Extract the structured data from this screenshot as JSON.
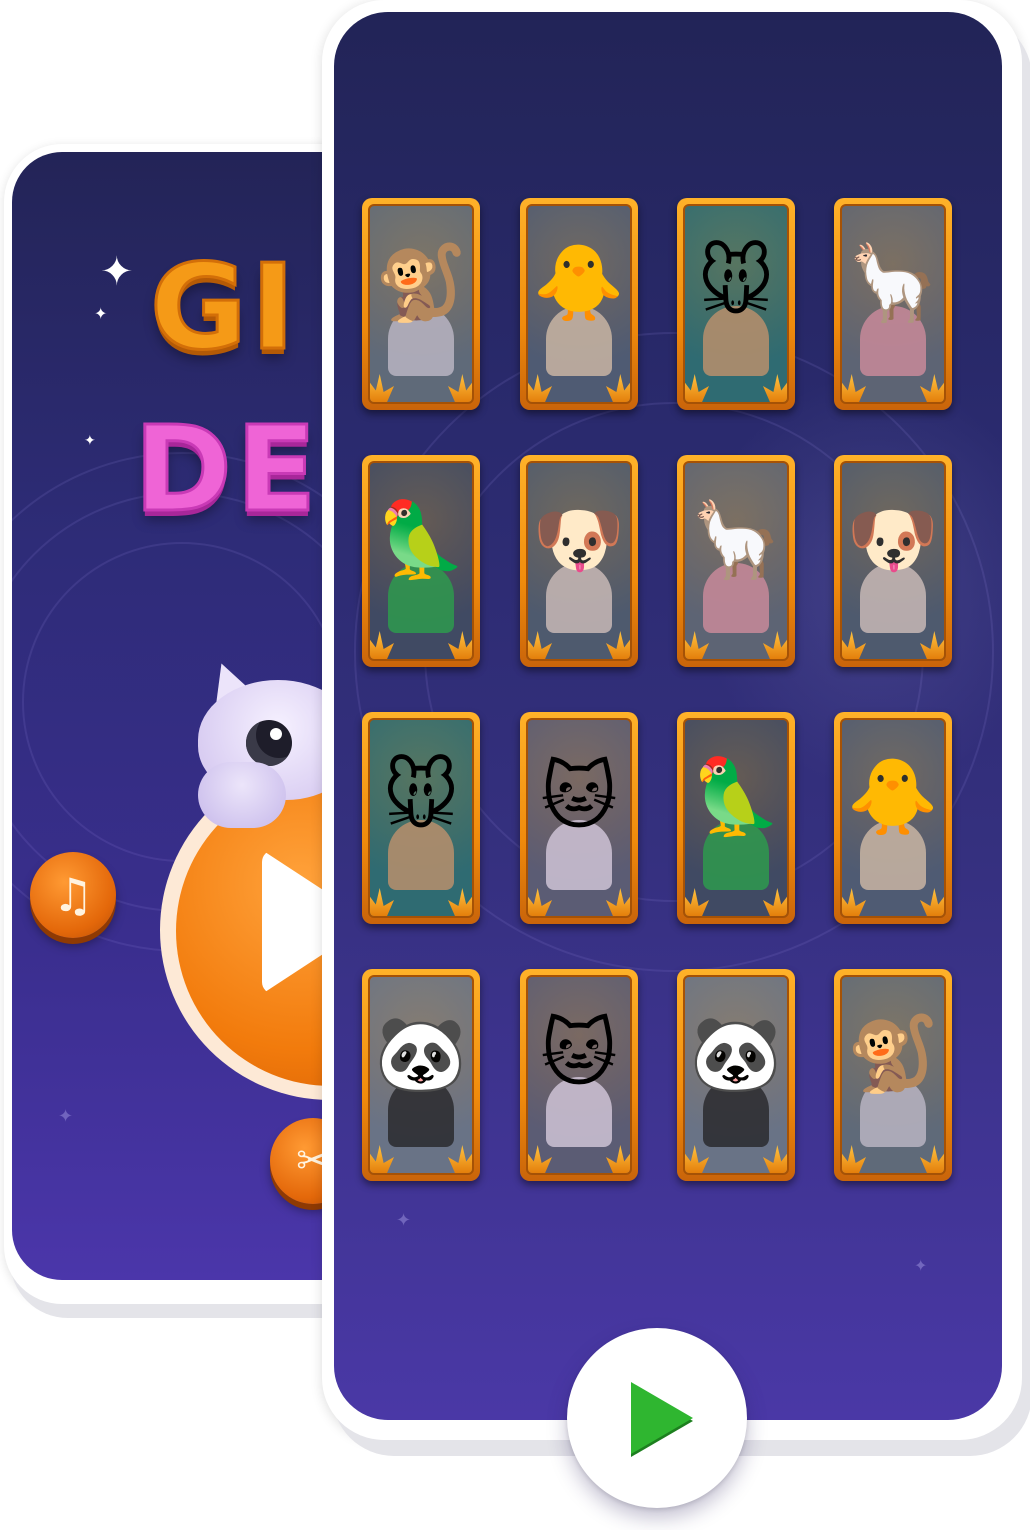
{
  "back_screen": {
    "title_line_1": "GI",
    "title_line_2": "DE",
    "music_icon": "♫",
    "share_icon": "✂"
  },
  "front_screen": {
    "cards": [
      {
        "animal": "monkey",
        "emoji": "🐒",
        "bg": "#5f6a79",
        "body": "#b8b4c2"
      },
      {
        "animal": "chick",
        "emoji": "🐥",
        "bg": "#4f5b73",
        "body": "#c9b5a3"
      },
      {
        "animal": "mouse",
        "emoji": "🐭",
        "bg": "#2f6b72",
        "body": "#b98f6c"
      },
      {
        "animal": "llama",
        "emoji": "🦙",
        "bg": "#5d6474",
        "body": "#c88a9a"
      },
      {
        "animal": "parrot",
        "emoji": "🦜",
        "bg": "#404a63",
        "body": "#2e9a4d"
      },
      {
        "animal": "puppy",
        "emoji": "🐶",
        "bg": "#4e5a6e",
        "body": "#c8b8b6"
      },
      {
        "animal": "llama",
        "emoji": "🦙",
        "bg": "#5d6474",
        "body": "#c88a9a"
      },
      {
        "animal": "puppy",
        "emoji": "🐶",
        "bg": "#4e5a6e",
        "body": "#c8b8b6"
      },
      {
        "animal": "mouse",
        "emoji": "🐭",
        "bg": "#2f6b72",
        "body": "#b98f6c"
      },
      {
        "animal": "kitten",
        "emoji": "🐱",
        "bg": "#5b5c74",
        "body": "#cfc3d6"
      },
      {
        "animal": "parrot",
        "emoji": "🦜",
        "bg": "#404a63",
        "body": "#2e9a4d"
      },
      {
        "animal": "chick",
        "emoji": "🐥",
        "bg": "#4f5b73",
        "body": "#c9b5a3"
      },
      {
        "animal": "panda",
        "emoji": "🐼",
        "bg": "#697386",
        "body": "#2a2a2e"
      },
      {
        "animal": "kitten",
        "emoji": "🐱",
        "bg": "#5b5c74",
        "body": "#cfc3d6"
      },
      {
        "animal": "panda",
        "emoji": "🐼",
        "bg": "#697386",
        "body": "#2a2a2e"
      },
      {
        "animal": "monkey",
        "emoji": "🐒",
        "bg": "#5f6a79",
        "body": "#b8b4c2"
      }
    ],
    "play_icon": "play-icon"
  },
  "colors": {
    "card_frame": "#f08b0c",
    "play_green": "#2fb630",
    "bg_purple": "#35307f"
  }
}
